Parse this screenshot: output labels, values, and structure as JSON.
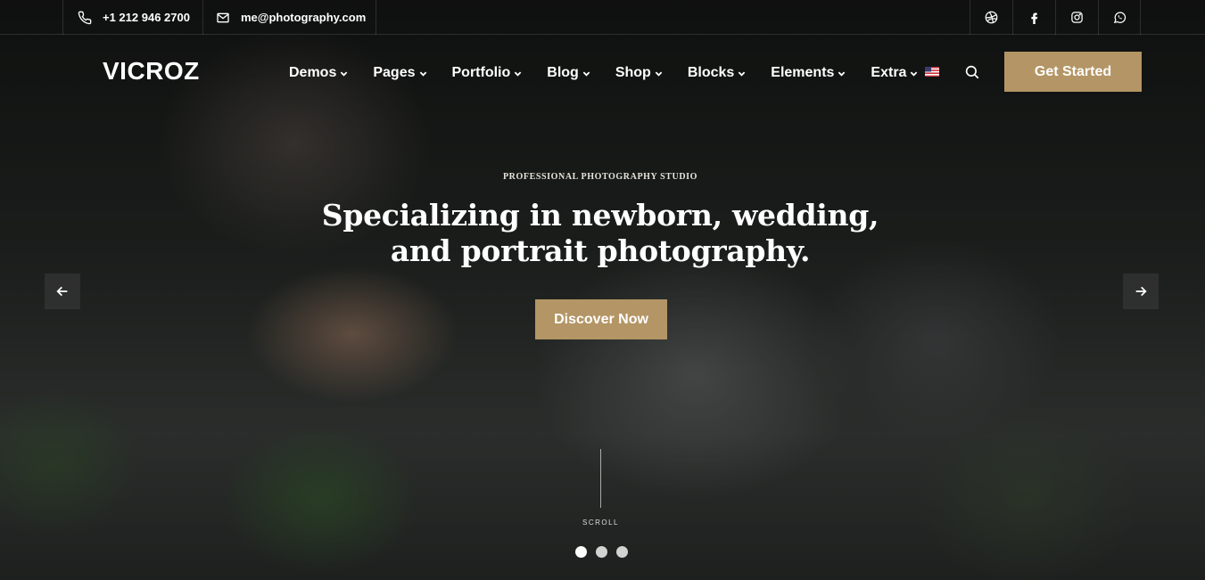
{
  "topbar": {
    "phone": "+1 212 946 2700",
    "email": "me@photography.com",
    "socials": [
      "dribbble-icon",
      "facebook-icon",
      "instagram-icon",
      "whatsapp-icon"
    ]
  },
  "header": {
    "logo": "VICROZ",
    "nav": [
      "Demos",
      "Pages",
      "Portfolio",
      "Blog",
      "Shop",
      "Blocks",
      "Elements",
      "Extra"
    ],
    "language_icon": "us-flag-icon",
    "search_icon": "search-icon",
    "cta_label": "Get Started"
  },
  "hero": {
    "kicker": "PROFESSIONAL PHOTOGRAPHY STUDIO",
    "headline_line1": "Specializing in newborn, wedding,",
    "headline_line2": "and portrait photography.",
    "button_label": "Discover Now",
    "scroll_label": "SCROLL",
    "slide_count": 3,
    "active_slide": 1
  },
  "colors": {
    "accent": "#b49565"
  }
}
